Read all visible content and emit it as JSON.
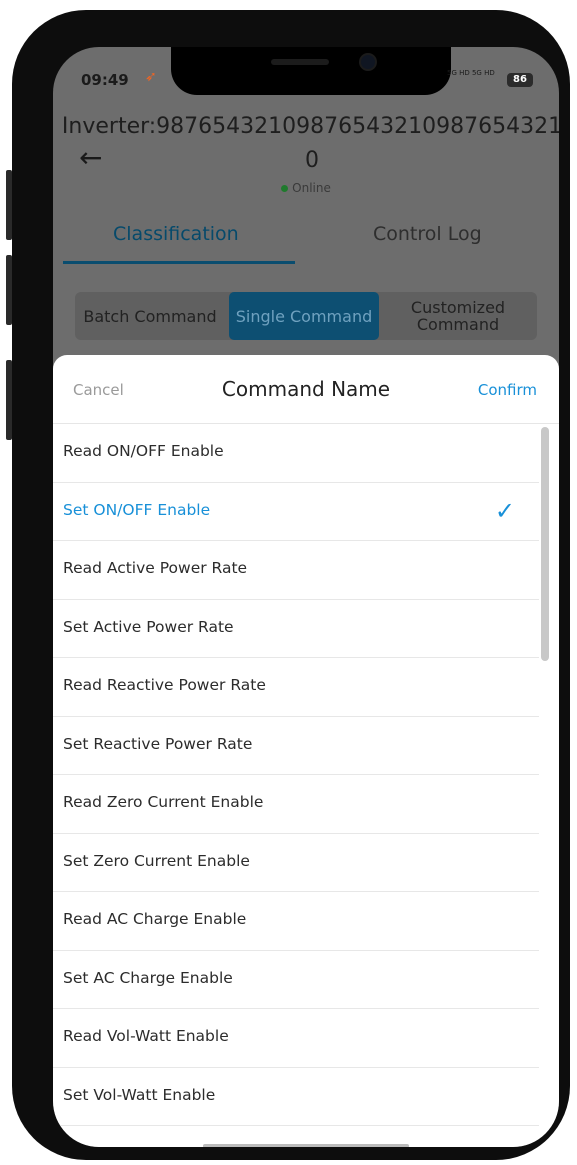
{
  "status": {
    "time": "09:49",
    "network": "5G HD 5G HD",
    "battery": "86"
  },
  "header": {
    "title": "Inverter:98765432109876543210987654321 0",
    "status": "Online"
  },
  "tabs": [
    {
      "label": "Classification"
    },
    {
      "label": "Control Log"
    }
  ],
  "segments": [
    {
      "label": "Batch Command"
    },
    {
      "label": "Single Command"
    },
    {
      "label": "Customized Command"
    }
  ],
  "sheet": {
    "cancel": "Cancel",
    "title": "Command Name",
    "confirm": "Confirm",
    "selected_index": 1,
    "items": [
      "Read ON/OFF Enable",
      "Set ON/OFF Enable",
      "Read Active Power Rate",
      "Set Active Power Rate",
      "Read Reactive Power Rate",
      "Set Reactive Power Rate",
      "Read Zero Current Enable",
      "Set Zero Current Enable",
      "Read AC Charge Enable",
      "Set AC Charge Enable",
      "Read Vol-Watt Enable",
      "Set Vol-Watt Enable"
    ]
  },
  "colors": {
    "accent": "#1890d8",
    "tab_active": "#064a6b",
    "overlay": "#6d6d6d"
  }
}
